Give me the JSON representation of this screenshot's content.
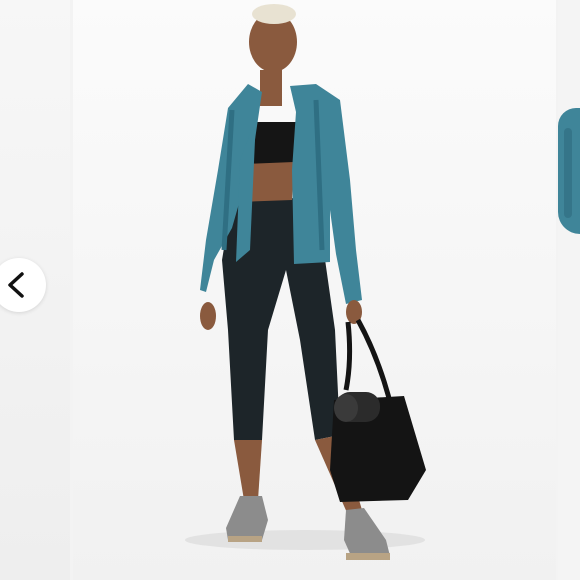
{
  "carousel": {
    "prev_icon": "chevron-left-icon",
    "colors": {
      "jacket": "#3f8599",
      "leggings": "#1d2529",
      "skin": "#8a5a3e",
      "bag": "#141414",
      "shoes": "#8c8c8c"
    }
  }
}
